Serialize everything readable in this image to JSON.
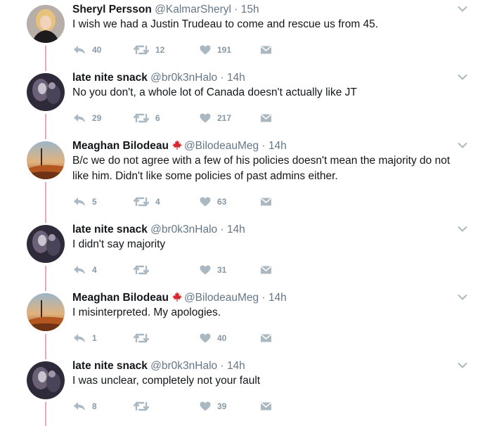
{
  "colors": {
    "thread_line": "#e8a7bb",
    "icon": "#aab8c2",
    "name": "#14171a",
    "meta": "#657786",
    "flag": "#d8262b"
  },
  "tweets": [
    {
      "name": "Sheryl Persson",
      "handle": "@KalmarSheryl",
      "time": "15h",
      "verified_flag": false,
      "text": "I wish we had a Justin Trudeau to come and rescue us from 45.",
      "avatar": "woman-portrait-avatar",
      "replies": "40",
      "retweets": "12",
      "likes": "191"
    },
    {
      "name": "late nite snack",
      "handle": "@br0k3nHalo",
      "time": "14h",
      "verified_flag": false,
      "text": "No you don't, a whole lot of Canada doesn't actually like JT",
      "avatar": "dark-blurred-avatar",
      "replies": "29",
      "retweets": "6",
      "likes": "217"
    },
    {
      "name": "Meaghan Bilodeau",
      "handle": "@BilodeauMeg",
      "time": "14h",
      "verified_flag": true,
      "text": "B/c we do not agree with a few of his policies doesn't mean the majority do not like him. Didn't like some policies of past admins either.",
      "avatar": "sunset-landscape-avatar",
      "replies": "5",
      "retweets": "4",
      "likes": "63"
    },
    {
      "name": "late nite snack",
      "handle": "@br0k3nHalo",
      "time": "14h",
      "verified_flag": false,
      "text": "I didn't say majority",
      "avatar": "dark-blurred-avatar",
      "replies": "4",
      "retweets": "",
      "likes": "31"
    },
    {
      "name": "Meaghan Bilodeau",
      "handle": "@BilodeauMeg",
      "time": "14h",
      "verified_flag": true,
      "text": "I misinterpreted. My apologies.",
      "avatar": "sunset-landscape-avatar",
      "replies": "1",
      "retweets": "",
      "likes": "40"
    },
    {
      "name": "late nite snack",
      "handle": "@br0k3nHalo",
      "time": "14h",
      "verified_flag": false,
      "text": "I was unclear, completely not your fault",
      "avatar": "dark-blurred-avatar",
      "replies": "8",
      "retweets": "",
      "likes": "39"
    }
  ]
}
